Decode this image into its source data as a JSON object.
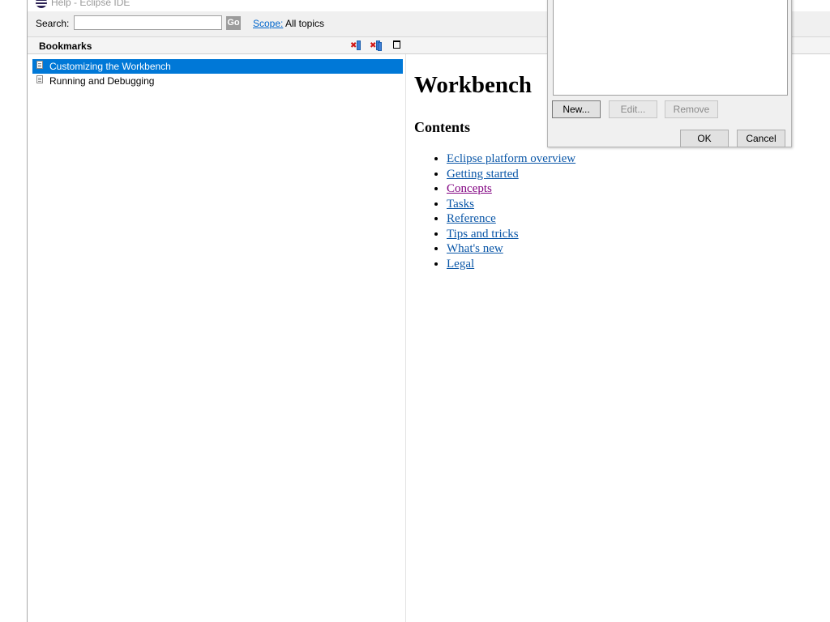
{
  "window": {
    "title": "Help - Eclipse IDE"
  },
  "search": {
    "label": "Search:",
    "value": "",
    "go_label": "Go",
    "scope_label": "Scope:",
    "scope_value": "All topics"
  },
  "bookmarks": {
    "title": "Bookmarks",
    "toolbar": [
      "delete-bookmark-icon",
      "delete-all-bookmarks-icon",
      "maximize-icon"
    ],
    "items": [
      {
        "label": "Customizing the Workbench",
        "selected": true
      },
      {
        "label": "Running and Debugging",
        "selected": false
      }
    ]
  },
  "content": {
    "heading": "Workbench",
    "subheading": "Contents",
    "links": [
      {
        "label": "Eclipse platform overview",
        "visited": false
      },
      {
        "label": "Getting started",
        "visited": false
      },
      {
        "label": "Concepts",
        "visited": true
      },
      {
        "label": "Tasks",
        "visited": false
      },
      {
        "label": "Reference",
        "visited": false
      },
      {
        "label": "Tips and tricks",
        "visited": false
      },
      {
        "label": "What's new",
        "visited": false
      },
      {
        "label": "Legal",
        "visited": false
      }
    ],
    "link_color": "#0b57a8",
    "visited_color": "#800080"
  },
  "dialog": {
    "buttons": {
      "new": "New...",
      "edit": "Edit...",
      "remove": "Remove",
      "ok": "OK",
      "cancel": "Cancel"
    }
  },
  "colors": {
    "selection": "#0078d7",
    "link": "#0066cc"
  }
}
